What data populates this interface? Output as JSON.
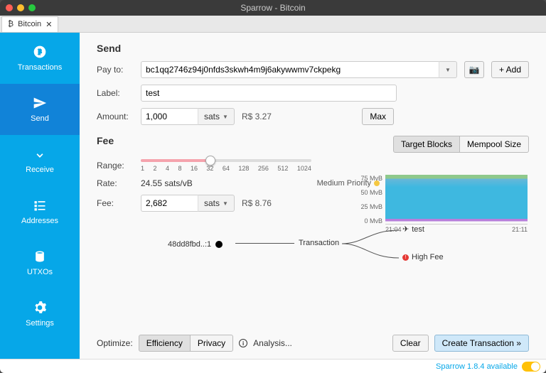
{
  "window": {
    "title": "Sparrow - Bitcoin"
  },
  "tab": {
    "label": "Bitcoin"
  },
  "sidebar": {
    "items": [
      {
        "label": "Transactions"
      },
      {
        "label": "Send"
      },
      {
        "label": "Receive"
      },
      {
        "label": "Addresses"
      },
      {
        "label": "UTXOs"
      },
      {
        "label": "Settings"
      }
    ]
  },
  "send": {
    "heading": "Send",
    "payto_label": "Pay to:",
    "payto_value": "bc1qq2746z94j0nfds3skwh4m9j6akywwmv7ckpekg",
    "add_label": "+ Add",
    "label_label": "Label:",
    "label_value": "test",
    "amount_label": "Amount:",
    "amount_value": "1,000",
    "amount_unit": "sats",
    "amount_converted": "R$ 3.27",
    "max_label": "Max"
  },
  "fee": {
    "heading": "Fee",
    "target_blocks": "Target Blocks",
    "mempool_size": "Mempool Size",
    "range_label": "Range:",
    "ticks": [
      "1",
      "2",
      "4",
      "8",
      "16",
      "32",
      "64",
      "128",
      "256",
      "512",
      "1024"
    ],
    "rate_label": "Rate:",
    "rate_value": "24.55 sats/vB",
    "priority": "Medium Priority",
    "fee_label": "Fee:",
    "fee_value": "2,682",
    "fee_unit": "sats",
    "fee_converted": "R$ 8.76"
  },
  "chart_data": {
    "type": "area",
    "ylabels": [
      "75 MvB",
      "50 MvB",
      "25 MvB",
      "0 MvB"
    ],
    "xlabels": [
      "21:04",
      "21:11"
    ]
  },
  "diagram": {
    "input": "48dd8fbd..:1",
    "tx": "Transaction",
    "out1": "test",
    "out2": "High Fee"
  },
  "footer": {
    "optimize_label": "Optimize:",
    "efficiency": "Efficiency",
    "privacy": "Privacy",
    "analysis": "Analysis...",
    "clear": "Clear",
    "create": "Create Transaction »"
  },
  "status": {
    "text": "Sparrow 1.8.4 available"
  }
}
